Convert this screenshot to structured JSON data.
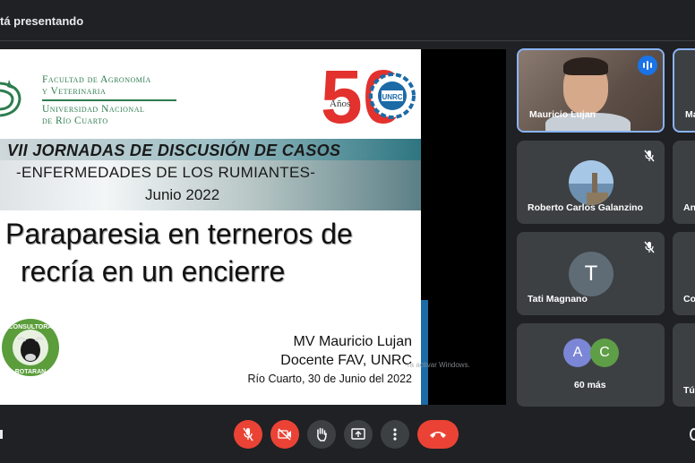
{
  "topbar": {
    "presenting_text": "tá presentando"
  },
  "slide": {
    "faculty_lines": [
      "Facultad de Agronomía",
      "y Veterinaria",
      "Universidad Nacional",
      "de Río Cuarto"
    ],
    "anniversary_label": "Años",
    "anniversary_number": "50",
    "unrc_label": "UNRC",
    "title_line1": "VII JORNADAS DE DISCUSIÓN DE CASOS",
    "title_line2": "-ENFERMEDADES DE LOS RUMIANTES-",
    "title_line3": "Junio 2022",
    "headline_line1": "Paraparesia en terneros de",
    "headline_line2": "recría en un encierre",
    "consultora_text": "CONSULTORA",
    "consultora_text2": "ROTARAN",
    "author_name": "MV Mauricio Lujan",
    "author_role": "Docente FAV, UNRC",
    "author_place_date": "Río Cuarto, 30 de Junio del 2022",
    "watermark": "ra activar Windows."
  },
  "participants": [
    {
      "name": "Mauricio Lujan",
      "speaking": true
    },
    {
      "name": "Roberto Carlos Galanzino",
      "muted": true
    },
    {
      "name": "Tati Magnano",
      "initial": "T",
      "muted": true
    },
    {
      "more_label": "60 más",
      "initials": [
        "A",
        "C"
      ]
    }
  ],
  "right_partial_names": [
    "Ma",
    "An",
    "Co",
    "Tú"
  ],
  "controls": [
    "mic-off",
    "camera-off",
    "raise-hand",
    "present",
    "more",
    "hang-up"
  ],
  "colors": {
    "bg": "#202124",
    "tile": "#3c4043",
    "red": "#ea4335",
    "accent": "#8ab4f8"
  }
}
